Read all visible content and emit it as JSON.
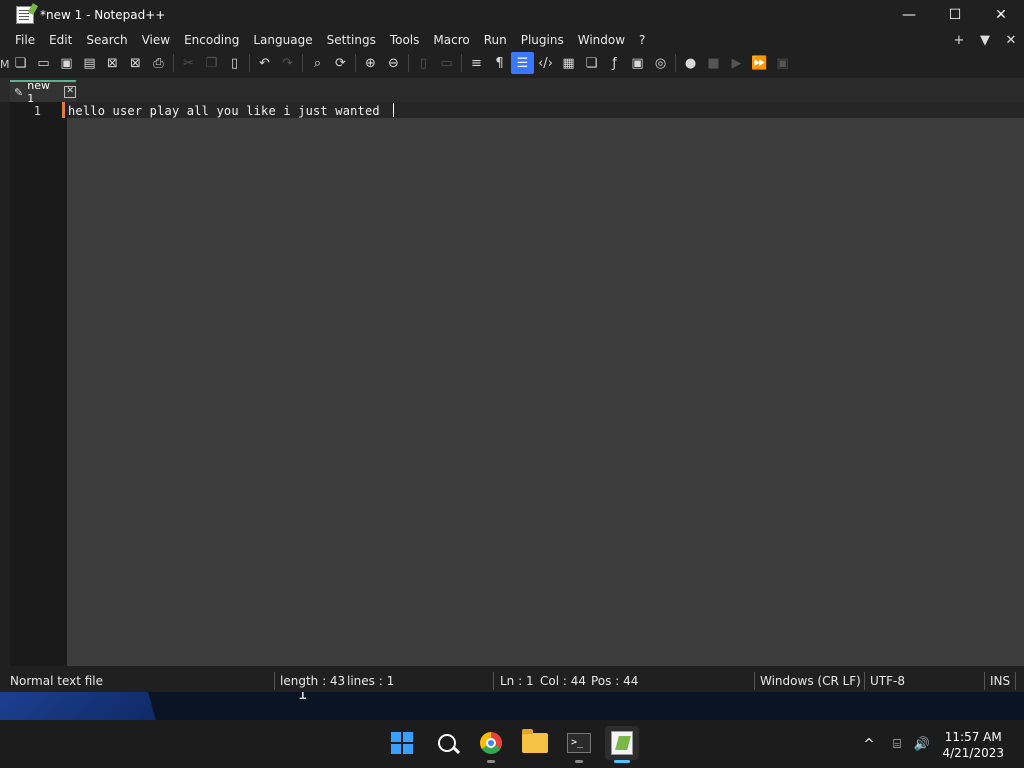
{
  "window": {
    "title": "*new 1 - Notepad++",
    "controls": {
      "minimize": "—",
      "maximize": "☐",
      "close": "✕"
    }
  },
  "menu": [
    "File",
    "Edit",
    "Search",
    "View",
    "Encoding",
    "Language",
    "Settings",
    "Tools",
    "Macro",
    "Run",
    "Plugins",
    "Window",
    "?"
  ],
  "menu_right": {
    "add": "+",
    "dropdown": "▼",
    "close": "✕"
  },
  "toolbar_stub": "M",
  "toolbar_icons": [
    "new-file-icon",
    "open-file-icon",
    "save-icon",
    "save-all-icon",
    "close-icon",
    "close-all-icon",
    "print-icon",
    "cut-icon",
    "copy-icon",
    "paste-icon",
    "undo-icon",
    "redo-icon",
    "find-icon",
    "replace-icon",
    "zoom-in-icon",
    "zoom-out-icon",
    "sync-vertical-icon",
    "sync-horizontal-icon",
    "word-wrap-icon",
    "show-all-characters-icon",
    "indent-guide-icon",
    "language-xml-icon",
    "document-map-icon",
    "document-list-icon",
    "function-list-icon",
    "folder-as-workspace-icon",
    "monitoring-icon",
    "record-macro-icon",
    "stop-record-icon",
    "play-macro-icon",
    "run-macro-multiple-icon",
    "save-macro-icon"
  ],
  "tab": {
    "label": "new 1",
    "close": "✕"
  },
  "editor": {
    "line_number": "1",
    "text": "hello user play all you like i just wanted "
  },
  "status": {
    "file_type": "Normal text file",
    "length": "length : 43",
    "lines": "lines : 1",
    "ln": "Ln : 1",
    "col": "Col : 44",
    "pos": "Pos : 44",
    "eol": "Windows (CR LF)",
    "encoding": "UTF-8",
    "mode": "INS"
  },
  "taskbar": {
    "apps": [
      "start-icon",
      "search-icon",
      "chrome-icon",
      "file-explorer-icon",
      "terminal-icon",
      "notepad-plus-plus-icon"
    ],
    "terminal_glyph": ">_",
    "tray": {
      "chevron": "^",
      "network": "⌸",
      "volume": "🔊"
    },
    "time": "11:57 AM",
    "date": "4/21/2023"
  },
  "colors": {
    "accent_tab": "#5ab38f",
    "active_toolbar": "#3b78ff",
    "line_marker": "#e07b39",
    "taskbar_active": "#4cc2ff"
  }
}
